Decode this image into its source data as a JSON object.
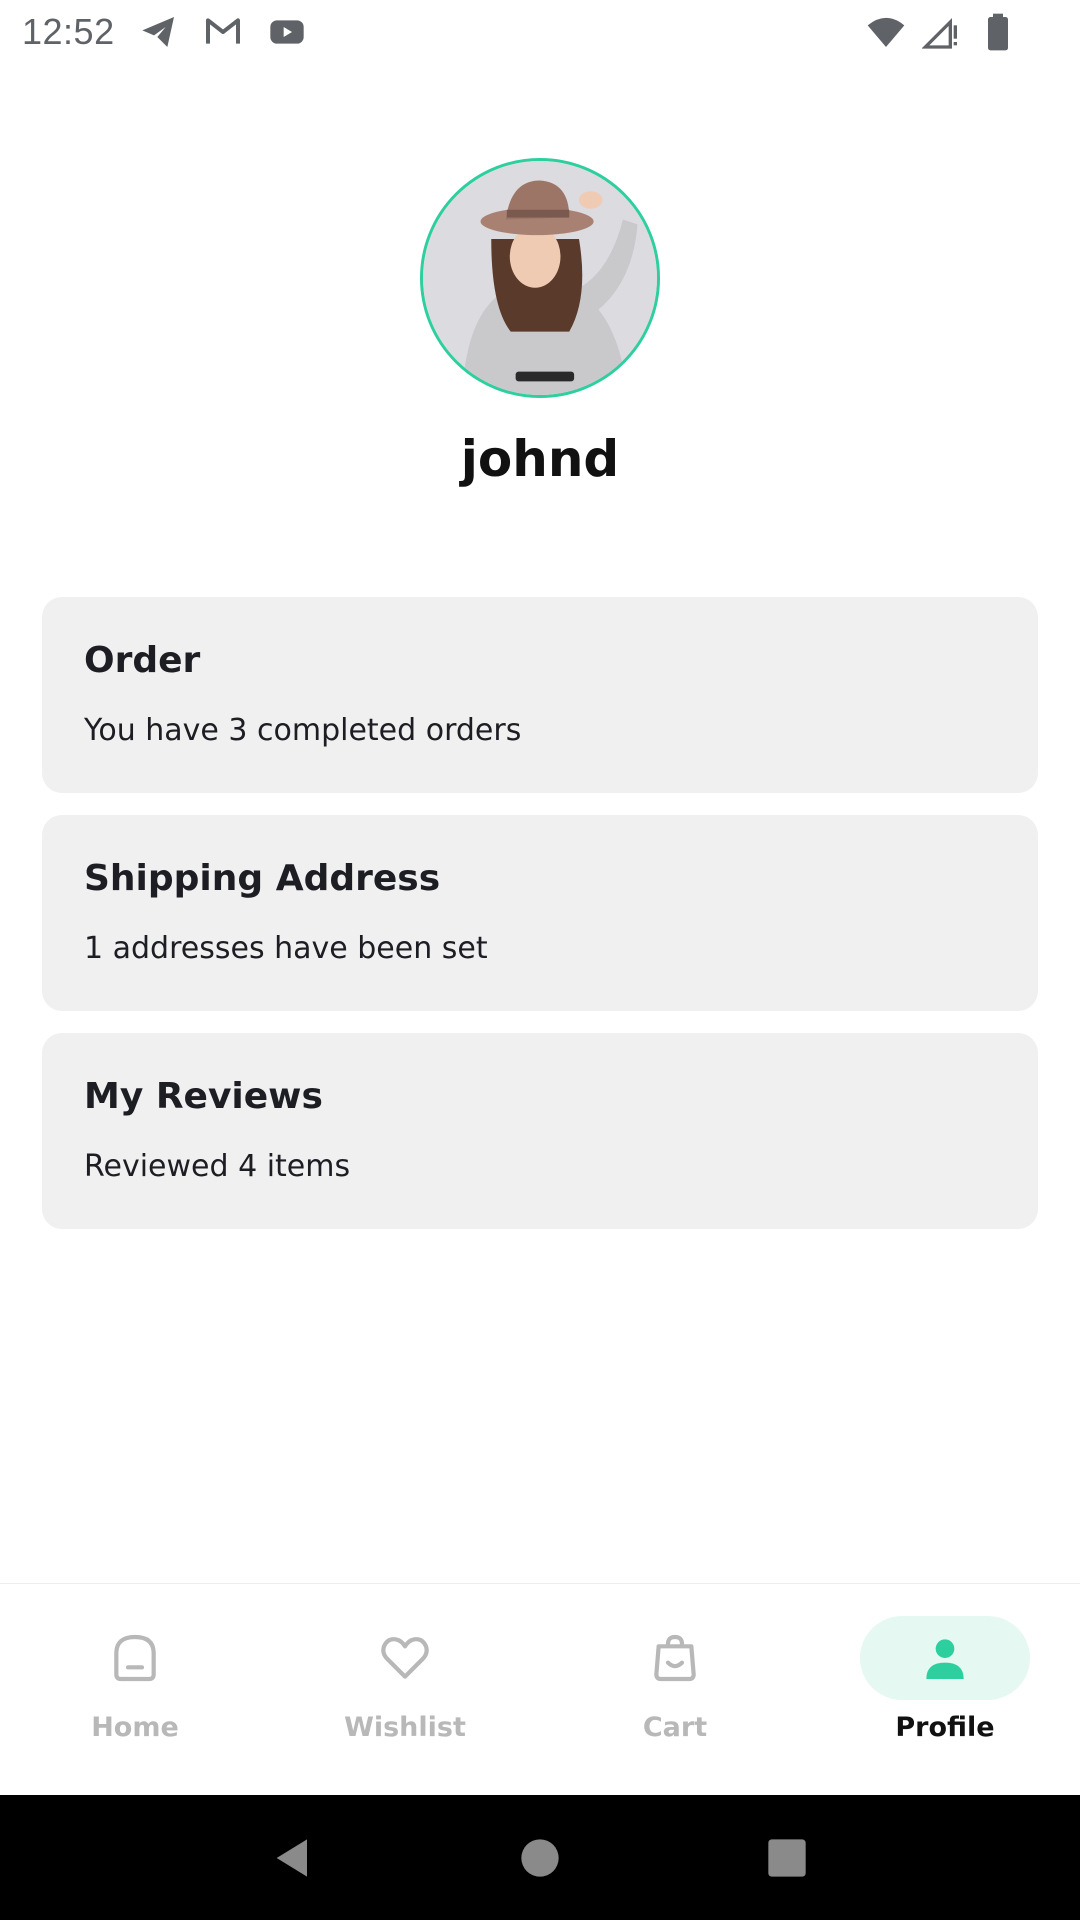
{
  "status_bar": {
    "time": "12:52",
    "left_icons": [
      "telegram-icon",
      "gmail-icon",
      "youtube-icon"
    ],
    "right_icons": [
      "wifi-icon",
      "cell-signal-icon",
      "battery-icon"
    ]
  },
  "profile": {
    "username": "johnd",
    "avatar_border_color": "#2ecf9e"
  },
  "cards": {
    "order": {
      "title": "Order",
      "subtitle": "You have 3 completed orders"
    },
    "shipping": {
      "title": "Shipping Address",
      "subtitle": "1 addresses have been set"
    },
    "reviews": {
      "title": "My Reviews",
      "subtitle": "Reviewed 4 items"
    }
  },
  "bottom_nav": {
    "items": [
      {
        "label": "Home",
        "icon": "home-icon",
        "active": false
      },
      {
        "label": "Wishlist",
        "icon": "heart-icon",
        "active": false
      },
      {
        "label": "Cart",
        "icon": "shopping-bag-icon",
        "active": false
      },
      {
        "label": "Profile",
        "icon": "user-icon",
        "active": true
      }
    ],
    "accent_color": "#2ecf9e",
    "active_pill_color": "#e6f8f2",
    "inactive_color": "#b8b8b8"
  },
  "system_nav": {
    "buttons": [
      "back-icon",
      "home-circle-icon",
      "recents-icon"
    ]
  }
}
